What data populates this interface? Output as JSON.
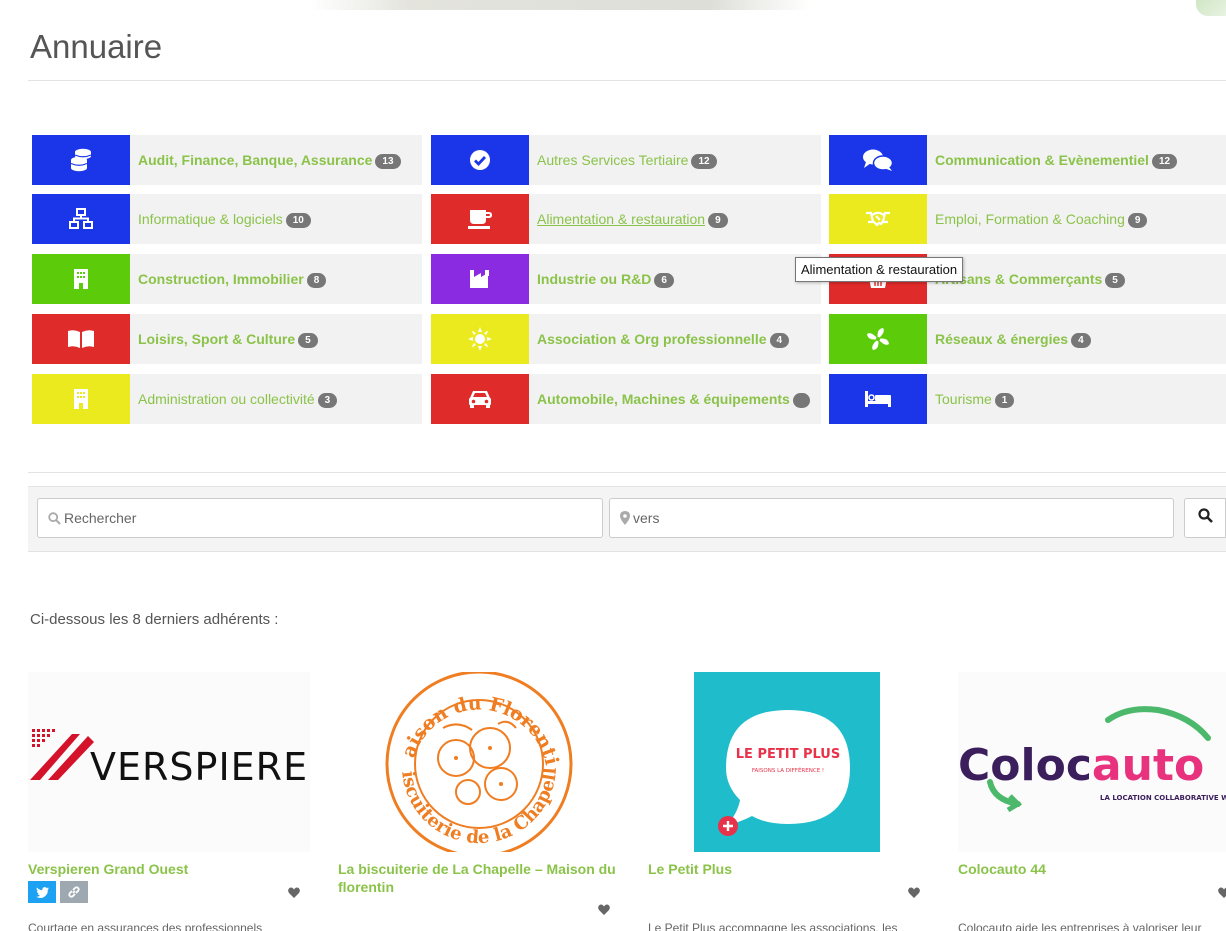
{
  "page": {
    "title": "Annuaire"
  },
  "categories": [
    {
      "label": "Audit, Finance, Banque, Assurance",
      "count": "13",
      "icon": "coins-icon",
      "color": "#1a36e8"
    },
    {
      "label": "Autres Services Tertiaire",
      "count": "12",
      "icon": "check-circle-icon",
      "color": "#1a36e8"
    },
    {
      "label": "Communication & Evènementiel",
      "count": "12",
      "icon": "comments-icon",
      "color": "#1a36e8"
    },
    {
      "label": "Informatique & logiciels",
      "count": "10",
      "icon": "sitemap-icon",
      "color": "#1a36e8"
    },
    {
      "label": "Alimentation & restauration",
      "count": "9",
      "icon": "coffee-cup-icon",
      "color": "#e02b2b"
    },
    {
      "label": "Emploi, Formation & Coaching",
      "count": "9",
      "icon": "handshake-icon",
      "color": "#eaea1f"
    },
    {
      "label": "Construction, Immobilier",
      "count": "8",
      "icon": "building-icon",
      "color": "#5ccc0a"
    },
    {
      "label": "Industrie ou R&D",
      "count": "6",
      "icon": "industry-icon",
      "color": "#8a2be2"
    },
    {
      "label": "Artisans & Commerçants",
      "count": "5",
      "icon": "basket-icon",
      "color": "#e02b2b"
    },
    {
      "label": "Loisirs, Sport & Culture",
      "count": "5",
      "icon": "book-open-icon",
      "color": "#e02b2b"
    },
    {
      "label": "Association & Org professionnelle",
      "count": "4",
      "icon": "sun-icon",
      "color": "#eaea1f"
    },
    {
      "label": "Réseaux & énergies",
      "count": "4",
      "icon": "fan-icon",
      "color": "#5ccc0a"
    },
    {
      "label": "Administration ou collectivité",
      "count": "3",
      "icon": "building-icon",
      "color": "#eaea1f"
    },
    {
      "label": "Automobile, Machines & équipements",
      "count": "",
      "icon": "car-icon",
      "color": "#e02b2b"
    },
    {
      "label": "Tourisme",
      "count": "1",
      "icon": "bed-icon",
      "color": "#1a36e8"
    }
  ],
  "tooltip": {
    "text": "Alimentation & restauration"
  },
  "search": {
    "keyword_placeholder": "Rechercher",
    "location_placeholder": "vers"
  },
  "members": {
    "intro": "Ci-dessous les 8 derniers adhérents :",
    "items": [
      {
        "name": "Verspieren Grand Ouest",
        "logo_text": "VERSPIEREN",
        "desc": "Courtage en assurances des professionnels"
      },
      {
        "name": "La biscuiterie de La Chapelle – Maison du florentin",
        "logo_text_top": "Maison du Florentin",
        "logo_text_bottom": "Biscuiterie de la Chapelle",
        "desc": ""
      },
      {
        "name": "Le Petit Plus",
        "logo_title": "LE PETIT PLUS",
        "logo_sub": "FAISONS LA DIFFÉRENCE !",
        "desc": "Le Petit Plus accompagne les associations, les"
      },
      {
        "name": "Colocauto 44",
        "logo_title": "Colocauto",
        "logo_sub": "LA LOCATION COLLABORATIVE WIN WIN",
        "desc": "Colocauto aide les entreprises à valoriser leur"
      }
    ]
  }
}
